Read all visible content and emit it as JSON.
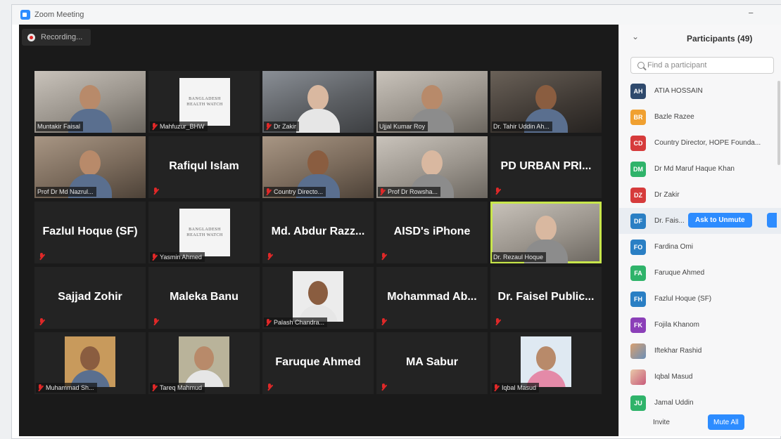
{
  "window": {
    "title": "Zoom Meeting",
    "minimize_glyph": "−"
  },
  "recording": {
    "label": "Recording..."
  },
  "tiles": {
    "r1c1": "Muntakir Faisal",
    "r1c2": "Mahfuzur_BHW",
    "r1c3": "Dr Zakir",
    "r1c4": "Ujjal Kumar Roy",
    "r1c5": "Dr. Tahir Uddin Ah...",
    "r2c1": "Prof Dr Md Nazrul...",
    "r2c2": "Rafiqul Islam",
    "r2c3": "Country Directo...",
    "r2c4": "Prof Dr Rowsha...",
    "r2c5": "PD URBAN PRI...",
    "r3c1": "Fazlul Hoque (SF)",
    "r3c2": "Yasmin Ahmed",
    "r3c3": "Md. Abdur Razz...",
    "r3c4": "AISD's iPhone",
    "r3c5": "Dr. Rezaul Hoque",
    "r4c1": "Sajjad Zohir",
    "r4c2": "Maleka Banu",
    "r4c3": "Palash Chandra...",
    "r4c4": "Mohammad Ab...",
    "r4c5": "Dr. Faisel Public...",
    "r5c1": "Muhammad Sh...",
    "r5c2": "Tareq Mahmud",
    "r5c3": "Faruque Ahmed",
    "r5c4": "MA Sabur",
    "r5c5": "Iqbal Masud"
  },
  "doc_text": {
    "line1": "BANGLADESH",
    "line2": "HEALTH WATCH"
  },
  "panel": {
    "title": "Participants (49)",
    "collapse_glyph": "⌄",
    "search_placeholder": "Find a participant",
    "ask_to_unmute": "Ask to Unmute",
    "invite": "Invite",
    "mute_all": "Mute All",
    "participants": [
      {
        "initials": "AH",
        "name": "ATIA HOSSAIN",
        "color": "#2f4a6d"
      },
      {
        "initials": "BR",
        "name": "Bazle Razee",
        "color": "#f0a030"
      },
      {
        "initials": "CD",
        "name": "Country Director, HOPE Founda...",
        "color": "#d63b3b"
      },
      {
        "initials": "DM",
        "name": "Dr Md Maruf Haque Khan",
        "color": "#2fb36a"
      },
      {
        "initials": "DZ",
        "name": "Dr Zakir",
        "color": "#d63b3b"
      },
      {
        "initials": "DF",
        "name": "Dr. Fais...",
        "color": "#2a7fc4"
      },
      {
        "initials": "FO",
        "name": "Fardina Omi",
        "color": "#2a7fc4"
      },
      {
        "initials": "FA",
        "name": "Faruque Ahmed",
        "color": "#2fb36a"
      },
      {
        "initials": "FH",
        "name": "Fazlul Hoque (SF)",
        "color": "#2a7fc4"
      },
      {
        "initials": "FK",
        "name": "Fojila Khanom",
        "color": "#8b3fb8"
      },
      {
        "initials": "",
        "name": "Iftekhar Rashid",
        "color": "#7a5cc4"
      },
      {
        "initials": "",
        "name": "Iqbal Masud",
        "color": "#d8a070"
      },
      {
        "initials": "JU",
        "name": "Jamal Uddin",
        "color": "#2fb36a"
      }
    ]
  }
}
